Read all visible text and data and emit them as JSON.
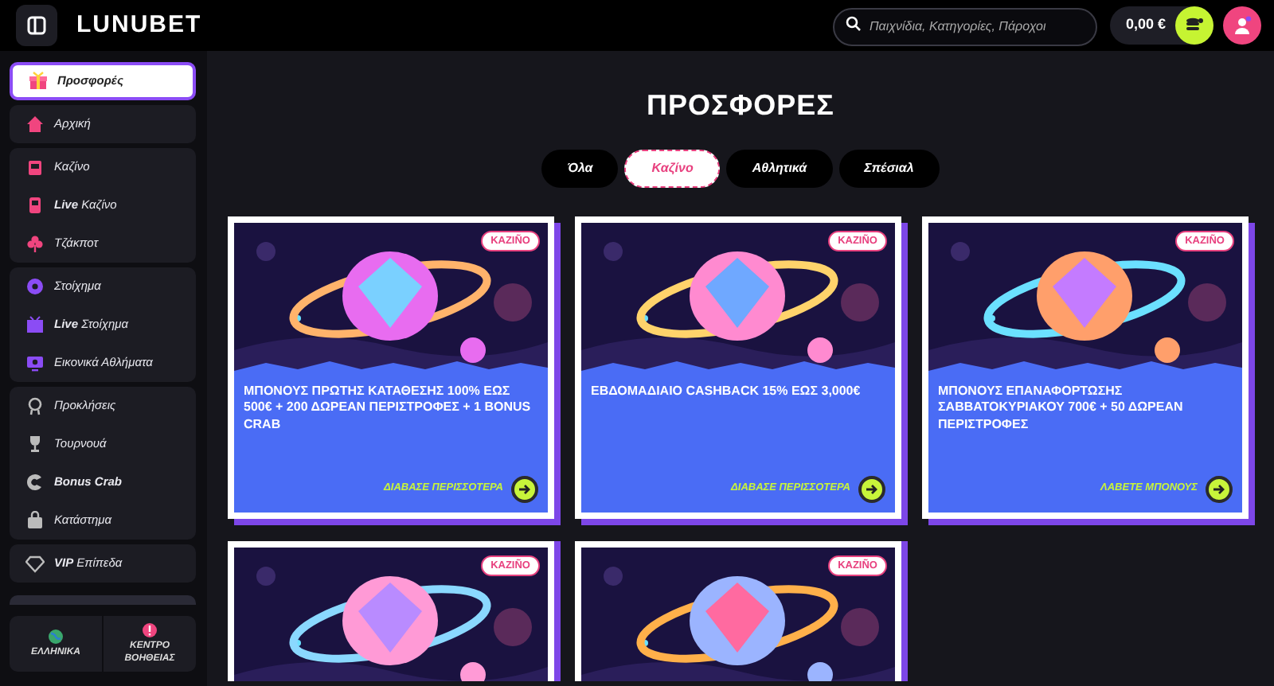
{
  "header": {
    "logo": "LUNUBET",
    "search": {
      "placeholder": "Παιχνίδια, Κατηγορίες, Πάροχοι"
    },
    "balance": "0,00 €"
  },
  "sidebar": {
    "groups": [
      {
        "items": [
          {
            "label": "Προσφορές",
            "selected": true
          }
        ]
      },
      {
        "items": [
          {
            "label": "Αρχική",
            "selected": false
          }
        ]
      },
      {
        "items": [
          {
            "label": "Καζίνο",
            "selected": false
          },
          {
            "label": "**Live** Καζίνο",
            "selected": false
          },
          {
            "label": "Τζάκποτ",
            "selected": false
          }
        ]
      },
      {
        "items": [
          {
            "label": "Στοίχημα",
            "selected": false
          },
          {
            "label": "**Live** Στοίχημα",
            "selected": false
          },
          {
            "label": "Εικονικά Αθλήματα",
            "selected": false
          }
        ]
      },
      {
        "items": [
          {
            "label": "Προκλήσεις",
            "selected": false
          },
          {
            "label": "Τουρνουά",
            "selected": false
          },
          {
            "label": "**Bonus Crab**",
            "selected": false
          },
          {
            "label": "Κατάστημα",
            "selected": false
          }
        ]
      },
      {
        "items": [
          {
            "label": "**VIP** Επίπεδα",
            "selected": false
          }
        ]
      }
    ],
    "footer": [
      {
        "label": "ΕΛΛΗΝΙΚΑ"
      },
      {
        "label": "ΚΕΝΤΡΟ ΒΟΗΘΕΙΑΣ"
      }
    ]
  },
  "page_title": "ΠΡΟΣΦΟΡΕΣ",
  "tabs": [
    {
      "label": "Όλα",
      "selected": false
    },
    {
      "label": "Καζίνο",
      "selected": true
    },
    {
      "label": "Αθλητικά",
      "selected": false
    },
    {
      "label": "Σπέσιαλ",
      "selected": false
    }
  ],
  "offers": [
    {
      "badge": "KAZIÑO",
      "title": "ΜΠΟΝΟΥΣ ΠΡΩΤΗΣ ΚΑΤΑΘΕΣΗΣ 100% ΕΩΣ 500€ + 200 ΔΩΡΕΑΝ ΠΕΡΙΣΤΡΟΦΕΣ + 1 BONUS CRAB",
      "link": "ΔΙΑΒΑΣΕ ΠΕΡΙΣΣΟΤΕΡΑ"
    },
    {
      "badge": "KAZIÑO",
      "title": "ΕΒΔΟΜΑΔΙΑΙΟ CASHBACK 15% ΕΩΣ 3,000€",
      "link": "ΔΙΑΒΑΣΕ ΠΕΡΙΣΣΟΤΕΡΑ"
    },
    {
      "badge": "KAZIÑO",
      "title": "ΜΠΟΝΟΥΣ ΕΠΑΝΑΦΟΡΤΩΣΗΣ ΣΑΒΒΑΤΟΚΥΡΙΑΚΟΥ 700€ + 50 ΔΩΡΕΑΝ ΠΕΡΙΣΤΡΟΦΕΣ",
      "link": "ΛΑΒΕΤΕ ΜΠΟΝΟΥΣ"
    },
    {
      "badge": "KAZIÑO"
    },
    {
      "badge": "KAZIÑO"
    }
  ]
}
